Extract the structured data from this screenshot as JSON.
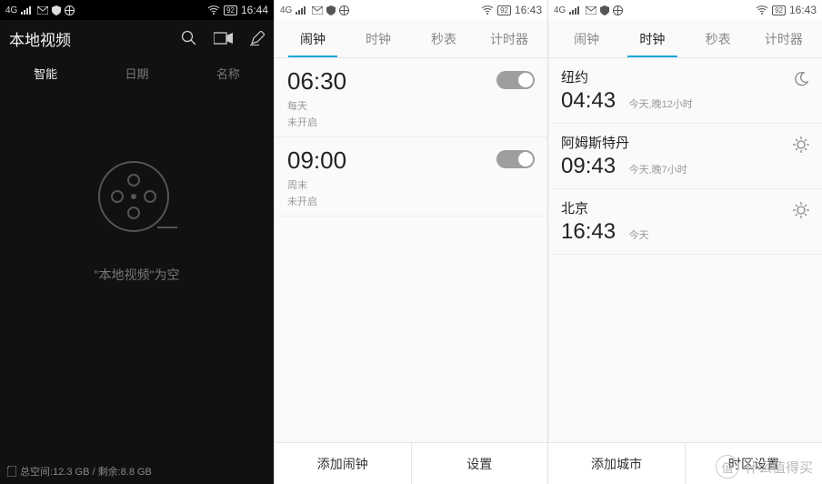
{
  "status": {
    "signal_label": "4G",
    "battery_text": "92",
    "p1_time": "16:44",
    "p2_time": "16:43",
    "p3_time": "16:43"
  },
  "video": {
    "title": "本地视频",
    "tabs": {
      "smart": "智能",
      "date": "日期",
      "name": "名称"
    },
    "empty_label": "\"本地视频\"为空",
    "storage": "总空间:12.3 GB / 剩余:8.8 GB"
  },
  "clock": {
    "tabs": {
      "alarm": "闹钟",
      "clock": "时钟",
      "stopwatch": "秒表",
      "timer": "计时器"
    },
    "alarms": [
      {
        "time": "06:30",
        "repeat": "每天",
        "status": "未开启"
      },
      {
        "time": "09:00",
        "repeat": "周末",
        "status": "未开启"
      }
    ],
    "bottom": {
      "add_alarm": "添加闹钟",
      "settings": "设置"
    }
  },
  "world": {
    "cities": [
      {
        "name": "纽约",
        "time": "04:43",
        "sub": "今天,晚12小时",
        "daynight": "night"
      },
      {
        "name": "阿姆斯特丹",
        "time": "09:43",
        "sub": "今天,晚7小时",
        "daynight": "day"
      },
      {
        "name": "北京",
        "time": "16:43",
        "sub": "今天",
        "daynight": "day"
      }
    ],
    "bottom": {
      "add_city": "添加城市",
      "tz_settings": "时区设置"
    }
  },
  "watermark": {
    "badge": "值",
    "text": "什么值得买"
  }
}
